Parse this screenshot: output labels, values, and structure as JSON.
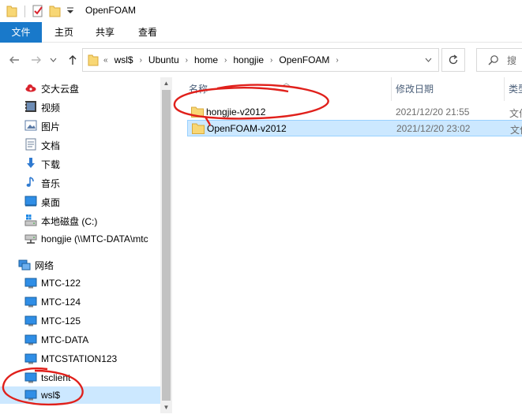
{
  "window": {
    "title": "OpenFOAM"
  },
  "ribbon": {
    "tabs": [
      {
        "label": "文件"
      },
      {
        "label": "主页"
      },
      {
        "label": "共享"
      },
      {
        "label": "查看"
      }
    ]
  },
  "address": {
    "overflow": "«",
    "crumbs": [
      "wsl$",
      "Ubuntu",
      "home",
      "hongjie",
      "OpenFOAM"
    ]
  },
  "search": {
    "placeholder": "搜"
  },
  "nav": {
    "items": [
      {
        "label": "交大云盘",
        "icon": "cloud-icon"
      },
      {
        "label": "视频",
        "icon": "video-folder-icon"
      },
      {
        "label": "图片",
        "icon": "pictures-folder-icon"
      },
      {
        "label": "文档",
        "icon": "documents-folder-icon"
      },
      {
        "label": "下载",
        "icon": "download-arrow-icon"
      },
      {
        "label": "音乐",
        "icon": "music-note-icon"
      },
      {
        "label": "桌面",
        "icon": "desktop-icon"
      },
      {
        "label": "本地磁盘 (C:)",
        "icon": "windows-drive-icon"
      },
      {
        "label": "hongjie (\\\\MTC-DATA\\mtc",
        "icon": "network-drive-icon"
      }
    ],
    "network": {
      "label": "网络",
      "items": [
        {
          "label": "MTC-122"
        },
        {
          "label": "MTC-124"
        },
        {
          "label": "MTC-125"
        },
        {
          "label": "MTC-DATA"
        },
        {
          "label": "MTCSTATION123"
        },
        {
          "label": "tsclient"
        },
        {
          "label": "wsl$"
        }
      ]
    }
  },
  "columns": {
    "name": "名称",
    "date": "修改日期",
    "type": "类型"
  },
  "files": [
    {
      "name": "hongjie-v2012",
      "date": "2021/12/20 21:55",
      "type": "文件",
      "selected": false
    },
    {
      "name": "OpenFOAM-v2012",
      "date": "2021/12/20 23:02",
      "type": "文件",
      "selected": true
    }
  ],
  "colors": {
    "accent": "#1979ca",
    "selection": "#cce8ff",
    "folder": "#f8d775",
    "annotation": "#e0201b"
  }
}
